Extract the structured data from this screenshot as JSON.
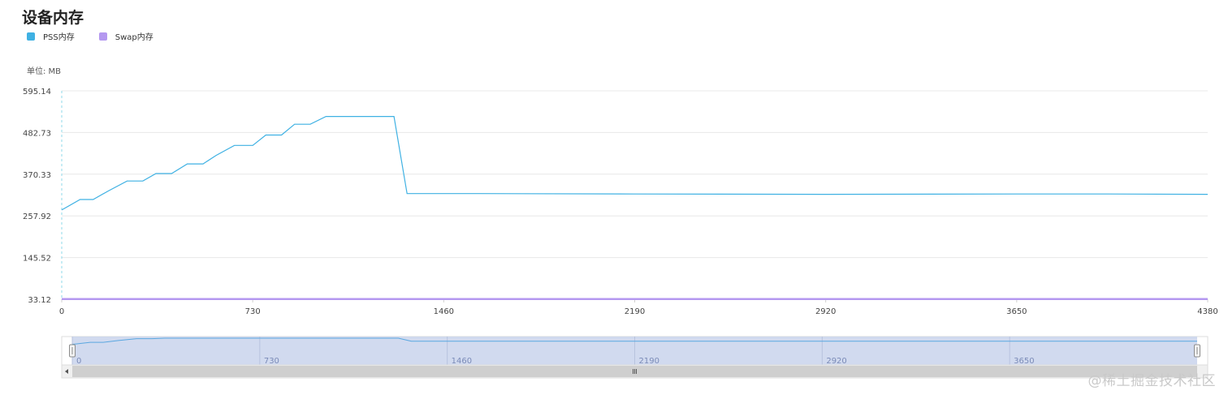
{
  "title": "设备内存",
  "unit_label": "单位: MB",
  "watermark": "@稀土掘金技术社区",
  "colors": {
    "pss": "#3fb1e3",
    "swap": "#b498f0",
    "grid": "#e8e8e8",
    "axis": "#d0d0d0",
    "slider_fill": "#c9d3ec",
    "slider_line": "#5aa7e0"
  },
  "legend": [
    {
      "label": "PSS内存",
      "color": "#3fb1e3"
    },
    {
      "label": "Swap内存",
      "color": "#b498f0"
    }
  ],
  "chart_data": {
    "type": "line",
    "title": "设备内存",
    "ylabel": "单位: MB",
    "xlabel": "",
    "xlim": [
      0,
      4380
    ],
    "ylim": [
      33.12,
      595.14
    ],
    "y_ticks": [
      "595.14",
      "482.73",
      "370.33",
      "257.92",
      "145.52",
      "33.12"
    ],
    "x_ticks": [
      "0",
      "730",
      "1460",
      "2190",
      "2920",
      "3650",
      "4380"
    ],
    "grid": true,
    "legend_position": "top-left",
    "series": [
      {
        "name": "PSS内存",
        "points": [
          [
            0,
            274
          ],
          [
            70,
            302
          ],
          [
            120,
            302
          ],
          [
            180,
            326
          ],
          [
            250,
            352
          ],
          [
            310,
            352
          ],
          [
            360,
            372
          ],
          [
            420,
            372
          ],
          [
            480,
            398
          ],
          [
            540,
            398
          ],
          [
            590,
            421
          ],
          [
            660,
            448
          ],
          [
            730,
            448
          ],
          [
            780,
            476
          ],
          [
            840,
            476
          ],
          [
            890,
            505
          ],
          [
            950,
            505
          ],
          [
            1010,
            526
          ],
          [
            1270,
            526
          ],
          [
            1320,
            318
          ],
          [
            1600,
            318
          ],
          [
            2190,
            317
          ],
          [
            2920,
            316
          ],
          [
            3650,
            317
          ],
          [
            4000,
            317
          ],
          [
            4380,
            316
          ]
        ]
      },
      {
        "name": "Swap内存",
        "points": [
          [
            0,
            33.5
          ],
          [
            4380,
            33.5
          ]
        ]
      }
    ],
    "data_zoom": {
      "range": [
        0,
        4380
      ],
      "ticks": [
        "0",
        "730",
        "1460",
        "2190",
        "2920",
        "3650"
      ]
    }
  }
}
